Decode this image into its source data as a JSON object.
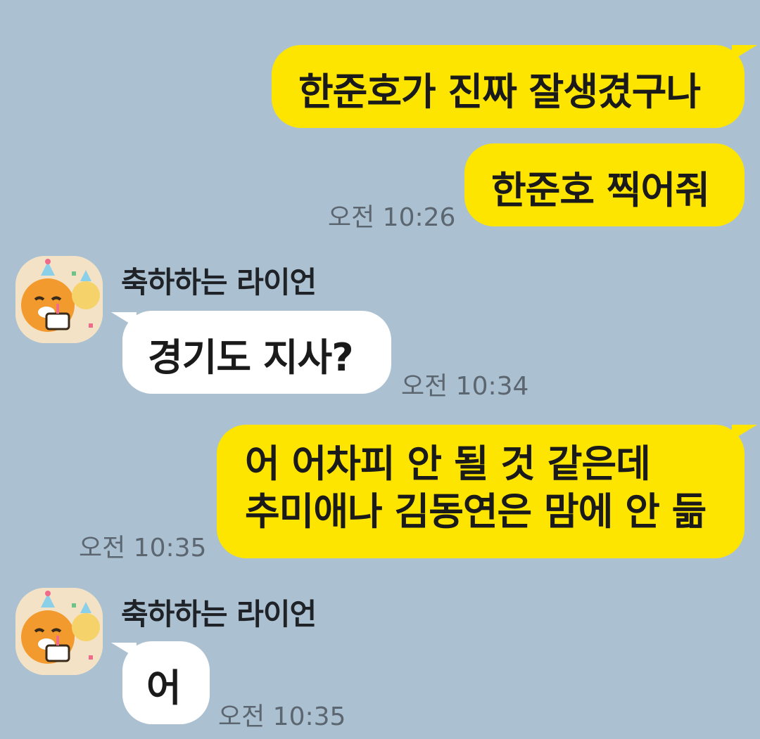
{
  "colors": {
    "background": "#abc1d1",
    "my_bubble": "#fee500",
    "other_bubble": "#ffffff",
    "timestamp": "#5c6670"
  },
  "messages": [
    {
      "from": "me",
      "text": "한준호가 진짜 잘생겼구나"
    },
    {
      "from": "me",
      "text": "한준호 찍어줘",
      "time": "오전 10:26"
    },
    {
      "from": "other",
      "sender": "축하하는 라이언",
      "avatar": "ryan-party-icon",
      "text": "경기도 지사?",
      "time": "오전 10:34"
    },
    {
      "from": "me",
      "lines": [
        "어 어차피 안 될 것 같은데",
        "추미애나 김동연은 맘에 안 듦"
      ],
      "time": "오전 10:35"
    },
    {
      "from": "other",
      "sender": "축하하는 라이언",
      "avatar": "ryan-party-icon",
      "text": "어",
      "time": "오전 10:35"
    }
  ]
}
